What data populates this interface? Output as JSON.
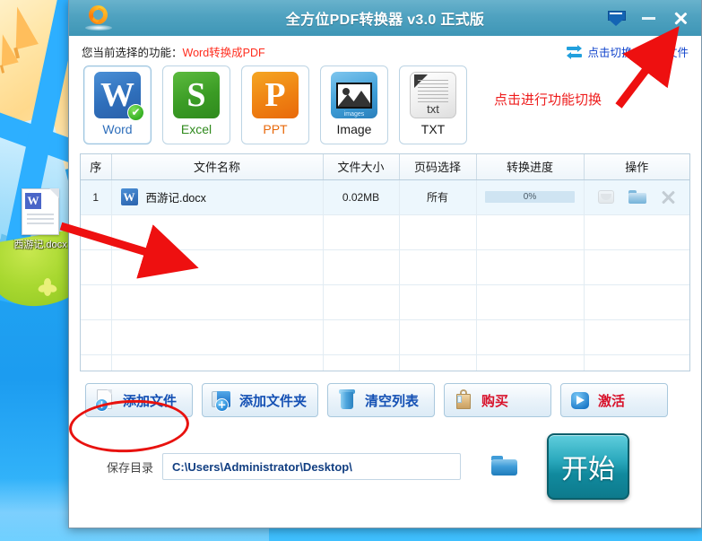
{
  "desktop": {
    "file_icon": {
      "name": "西游记.docx",
      "icon": "word-document-icon"
    }
  },
  "window": {
    "title": "全方位PDF转换器 v3.0 正式版",
    "logo_icon": "convert-arrows-logo-icon",
    "controls": [
      {
        "name": "minimize-to-tray-icon",
        "label": ""
      },
      {
        "name": "minimize-icon",
        "label": ""
      },
      {
        "name": "close-icon",
        "label": ""
      }
    ]
  },
  "func_bar": {
    "prefix": "您当前选择的功能：",
    "current": "Word转换成PDF",
    "switch_link": "点击切换PDF转文件",
    "switch_icon": "swap-arrows-icon"
  },
  "formats": [
    {
      "key": "word",
      "label": "Word",
      "glyph": "W",
      "selected": true,
      "badge": "✔"
    },
    {
      "key": "excel",
      "label": "Excel",
      "glyph": "S",
      "selected": false,
      "badge": ""
    },
    {
      "key": "ppt",
      "label": "PPT",
      "glyph": "P",
      "selected": false,
      "badge": ""
    },
    {
      "key": "image",
      "label": "Image",
      "glyph": "",
      "caption": "images",
      "selected": false,
      "badge": ""
    },
    {
      "key": "txt",
      "label": "TXT",
      "glyph": "",
      "caption": "txt",
      "selected": false,
      "badge": ""
    }
  ],
  "table": {
    "headers": [
      "序",
      "文件名称",
      "文件大小",
      "页码选择",
      "转换进度",
      "操作"
    ],
    "rows": [
      {
        "index": "1",
        "filename": "西游记.docx",
        "file_icon": "word-file-icon",
        "size": "0.02MB",
        "pages": "所有",
        "progress": "0%",
        "progress_pct": 0,
        "actions": [
          "preview-icon",
          "open-folder-icon",
          "remove-icon"
        ]
      }
    ],
    "empty_rows": 5
  },
  "buttons": [
    {
      "key": "add-file",
      "label": "添加文件",
      "icon": "add-file-icon",
      "red": false
    },
    {
      "key": "add-folder",
      "label": "添加文件夹",
      "icon": "add-folder-icon",
      "red": false
    },
    {
      "key": "clear-list",
      "label": "清空列表",
      "icon": "trash-icon",
      "red": false
    },
    {
      "key": "buy",
      "label": "购买",
      "icon": "shopping-bag-icon",
      "red": true
    },
    {
      "key": "activate",
      "label": "激活",
      "icon": "arrow-activate-icon",
      "red": true
    }
  ],
  "save": {
    "label": "保存目录",
    "path": "C:\\Users\\Administrator\\Desktop\\",
    "placeholder": "C:\\Users\\Administrator\\Desktop\\",
    "browse_icon": "browse-folder-icon",
    "start_label": "开始"
  },
  "annotations": {
    "switch_hint": "点击进行功能切换",
    "add_file_highlight": "ellipse-highlight-add-file",
    "drop_arrow": "drag-drop-arrow"
  },
  "colors": {
    "titlebar": "#4fa2c0",
    "accent_link": "#1144cc",
    "annotation_red": "#ee1c1c",
    "highlight_red": "#e8120f",
    "start_button": "#118a9e",
    "selected_text": "#ff2d1e"
  }
}
